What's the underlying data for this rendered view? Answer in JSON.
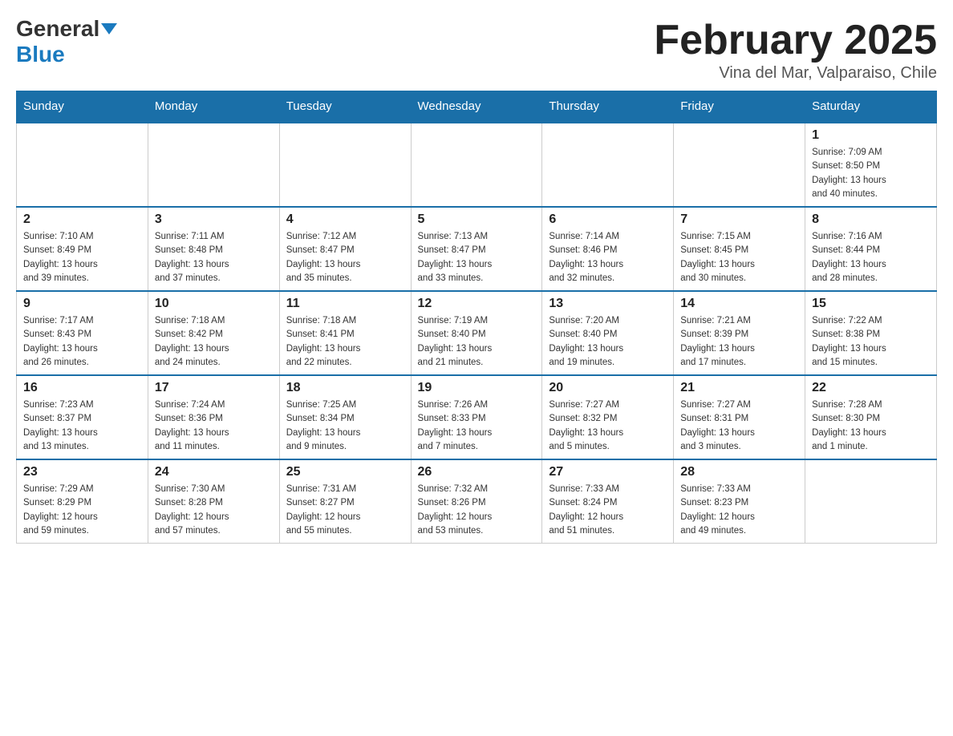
{
  "header": {
    "logo_general": "General",
    "logo_blue": "Blue",
    "month_title": "February 2025",
    "location": "Vina del Mar, Valparaiso, Chile"
  },
  "days_of_week": [
    "Sunday",
    "Monday",
    "Tuesday",
    "Wednesday",
    "Thursday",
    "Friday",
    "Saturday"
  ],
  "weeks": [
    {
      "days": [
        {
          "number": "",
          "info": ""
        },
        {
          "number": "",
          "info": ""
        },
        {
          "number": "",
          "info": ""
        },
        {
          "number": "",
          "info": ""
        },
        {
          "number": "",
          "info": ""
        },
        {
          "number": "",
          "info": ""
        },
        {
          "number": "1",
          "info": "Sunrise: 7:09 AM\nSunset: 8:50 PM\nDaylight: 13 hours\nand 40 minutes."
        }
      ]
    },
    {
      "days": [
        {
          "number": "2",
          "info": "Sunrise: 7:10 AM\nSunset: 8:49 PM\nDaylight: 13 hours\nand 39 minutes."
        },
        {
          "number": "3",
          "info": "Sunrise: 7:11 AM\nSunset: 8:48 PM\nDaylight: 13 hours\nand 37 minutes."
        },
        {
          "number": "4",
          "info": "Sunrise: 7:12 AM\nSunset: 8:47 PM\nDaylight: 13 hours\nand 35 minutes."
        },
        {
          "number": "5",
          "info": "Sunrise: 7:13 AM\nSunset: 8:47 PM\nDaylight: 13 hours\nand 33 minutes."
        },
        {
          "number": "6",
          "info": "Sunrise: 7:14 AM\nSunset: 8:46 PM\nDaylight: 13 hours\nand 32 minutes."
        },
        {
          "number": "7",
          "info": "Sunrise: 7:15 AM\nSunset: 8:45 PM\nDaylight: 13 hours\nand 30 minutes."
        },
        {
          "number": "8",
          "info": "Sunrise: 7:16 AM\nSunset: 8:44 PM\nDaylight: 13 hours\nand 28 minutes."
        }
      ]
    },
    {
      "days": [
        {
          "number": "9",
          "info": "Sunrise: 7:17 AM\nSunset: 8:43 PM\nDaylight: 13 hours\nand 26 minutes."
        },
        {
          "number": "10",
          "info": "Sunrise: 7:18 AM\nSunset: 8:42 PM\nDaylight: 13 hours\nand 24 minutes."
        },
        {
          "number": "11",
          "info": "Sunrise: 7:18 AM\nSunset: 8:41 PM\nDaylight: 13 hours\nand 22 minutes."
        },
        {
          "number": "12",
          "info": "Sunrise: 7:19 AM\nSunset: 8:40 PM\nDaylight: 13 hours\nand 21 minutes."
        },
        {
          "number": "13",
          "info": "Sunrise: 7:20 AM\nSunset: 8:40 PM\nDaylight: 13 hours\nand 19 minutes."
        },
        {
          "number": "14",
          "info": "Sunrise: 7:21 AM\nSunset: 8:39 PM\nDaylight: 13 hours\nand 17 minutes."
        },
        {
          "number": "15",
          "info": "Sunrise: 7:22 AM\nSunset: 8:38 PM\nDaylight: 13 hours\nand 15 minutes."
        }
      ]
    },
    {
      "days": [
        {
          "number": "16",
          "info": "Sunrise: 7:23 AM\nSunset: 8:37 PM\nDaylight: 13 hours\nand 13 minutes."
        },
        {
          "number": "17",
          "info": "Sunrise: 7:24 AM\nSunset: 8:36 PM\nDaylight: 13 hours\nand 11 minutes."
        },
        {
          "number": "18",
          "info": "Sunrise: 7:25 AM\nSunset: 8:34 PM\nDaylight: 13 hours\nand 9 minutes."
        },
        {
          "number": "19",
          "info": "Sunrise: 7:26 AM\nSunset: 8:33 PM\nDaylight: 13 hours\nand 7 minutes."
        },
        {
          "number": "20",
          "info": "Sunrise: 7:27 AM\nSunset: 8:32 PM\nDaylight: 13 hours\nand 5 minutes."
        },
        {
          "number": "21",
          "info": "Sunrise: 7:27 AM\nSunset: 8:31 PM\nDaylight: 13 hours\nand 3 minutes."
        },
        {
          "number": "22",
          "info": "Sunrise: 7:28 AM\nSunset: 8:30 PM\nDaylight: 13 hours\nand 1 minute."
        }
      ]
    },
    {
      "days": [
        {
          "number": "23",
          "info": "Sunrise: 7:29 AM\nSunset: 8:29 PM\nDaylight: 12 hours\nand 59 minutes."
        },
        {
          "number": "24",
          "info": "Sunrise: 7:30 AM\nSunset: 8:28 PM\nDaylight: 12 hours\nand 57 minutes."
        },
        {
          "number": "25",
          "info": "Sunrise: 7:31 AM\nSunset: 8:27 PM\nDaylight: 12 hours\nand 55 minutes."
        },
        {
          "number": "26",
          "info": "Sunrise: 7:32 AM\nSunset: 8:26 PM\nDaylight: 12 hours\nand 53 minutes."
        },
        {
          "number": "27",
          "info": "Sunrise: 7:33 AM\nSunset: 8:24 PM\nDaylight: 12 hours\nand 51 minutes."
        },
        {
          "number": "28",
          "info": "Sunrise: 7:33 AM\nSunset: 8:23 PM\nDaylight: 12 hours\nand 49 minutes."
        },
        {
          "number": "",
          "info": ""
        }
      ]
    }
  ]
}
